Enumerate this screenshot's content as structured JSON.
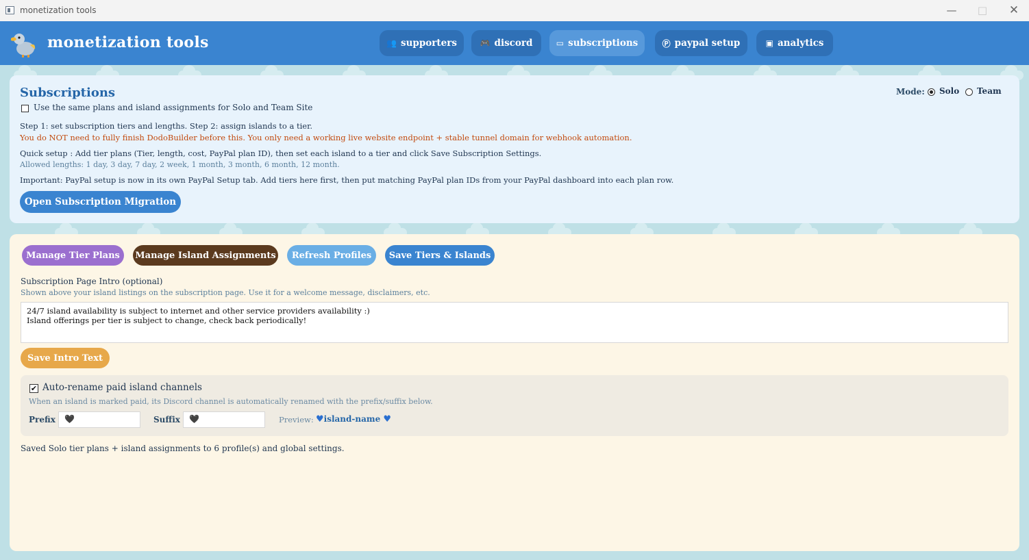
{
  "window": {
    "title": "monetization tools"
  },
  "header": {
    "brand": "monetization tools",
    "tabs": [
      {
        "label": "supporters",
        "icon": "users-icon"
      },
      {
        "label": "discord",
        "icon": "gamepad-icon"
      },
      {
        "label": "subscriptions",
        "icon": "card-icon",
        "active": true
      },
      {
        "label": "paypal setup",
        "icon": "paypal-icon"
      },
      {
        "label": "analytics",
        "icon": "chart-icon"
      }
    ]
  },
  "subscriptions": {
    "title": "Subscriptions",
    "same_plans_label": "Use the same plans and island assignments for Solo and Team Site",
    "mode_label": "Mode:",
    "mode_options": [
      "Solo",
      "Team"
    ],
    "mode_selected": "Solo",
    "step_text": "Step 1: set subscription tiers and lengths. Step 2: assign islands to a tier.",
    "warning_text": "You do NOT need to fully finish DodoBuilder before this. You only need a working live website endpoint + stable tunnel domain for webhook automation.",
    "quick_setup_text": "Quick setup : Add tier plans (Tier, length, cost, PayPal plan ID), then set each island to a tier and click Save Subscription Settings.",
    "allowed_lengths_text": "Allowed lengths: 1 day, 3 day, 7 day, 2 week, 1 month, 3 month, 6 month, 12 month.",
    "important_text": "Important:  PayPal setup is now in its own PayPal Setup tab. Add tiers here first, then put matching PayPal plan IDs from your PayPal dashboard into each plan row.",
    "migration_button": "Open Subscription Migration"
  },
  "actions": {
    "manage_tiers": "Manage Tier Plans",
    "manage_islands": "Manage Island Assignments",
    "refresh": "Refresh Profiles",
    "save": "Save Tiers & Islands"
  },
  "intro": {
    "label": "Subscription Page Intro (optional)",
    "help": "Shown above your island listings on the subscription page. Use it for a welcome message, disclaimers, etc.",
    "line1": "24/7 island availability is subject to internet and other service providers availability :)",
    "line2": "Island offerings per tier is subject to change, check back periodically!",
    "save_button": "Save Intro Text"
  },
  "rename": {
    "checked": true,
    "title": "Auto-rename paid island channels",
    "help": "When an island is marked paid, its Discord channel is automatically renamed with the prefix/suffix below.",
    "prefix_label": "Prefix",
    "prefix_value": "🖤",
    "suffix_label": "Suffix",
    "suffix_value": "🖤",
    "preview_label": "Preview:",
    "preview_name": "island-name"
  },
  "status": "Saved Solo tier plans + island assignments to 6 profile(s) and global settings."
}
